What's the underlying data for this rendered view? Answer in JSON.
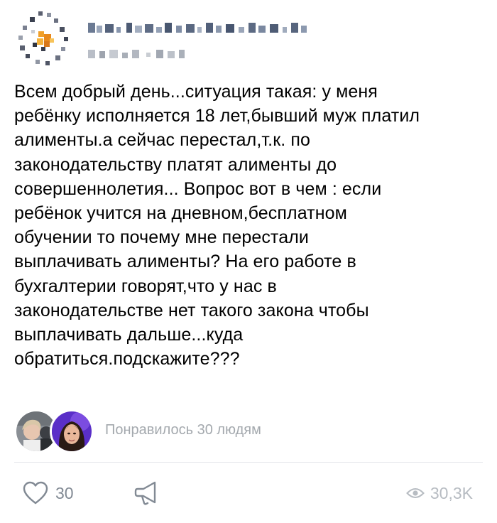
{
  "post": {
    "text": "Всем добрый день...ситуация такая: у меня\nребёнку исполняется 18 лет,бывший муж платил\nалименты.а сейчас перестал,т.к. по\nзаконодательству платят алименты до\nсовершеннолетия... Вопрос вот в чем : если\nребёнок учится на дневном,бесплатном\nобучении то почему мне перестали\nвыплачивать алименты? На его работе в\nбухгалтерии говорят,что у нас в\nзаконодательстве нет такого закона чтобы\nвыплачивать дальше...куда\nобратиться.подскажите???"
  },
  "likes_summary": {
    "text": "Понравилось 30 людям"
  },
  "actions": {
    "like_count": "30",
    "views_count": "30,3K"
  },
  "icons": {
    "like": "heart-icon",
    "share": "megaphone-share-icon",
    "views": "eye-icon"
  },
  "colors": {
    "muted_text": "#a4a9ae",
    "icon_gray": "#828a94",
    "views_gray": "#b7bcc2"
  }
}
